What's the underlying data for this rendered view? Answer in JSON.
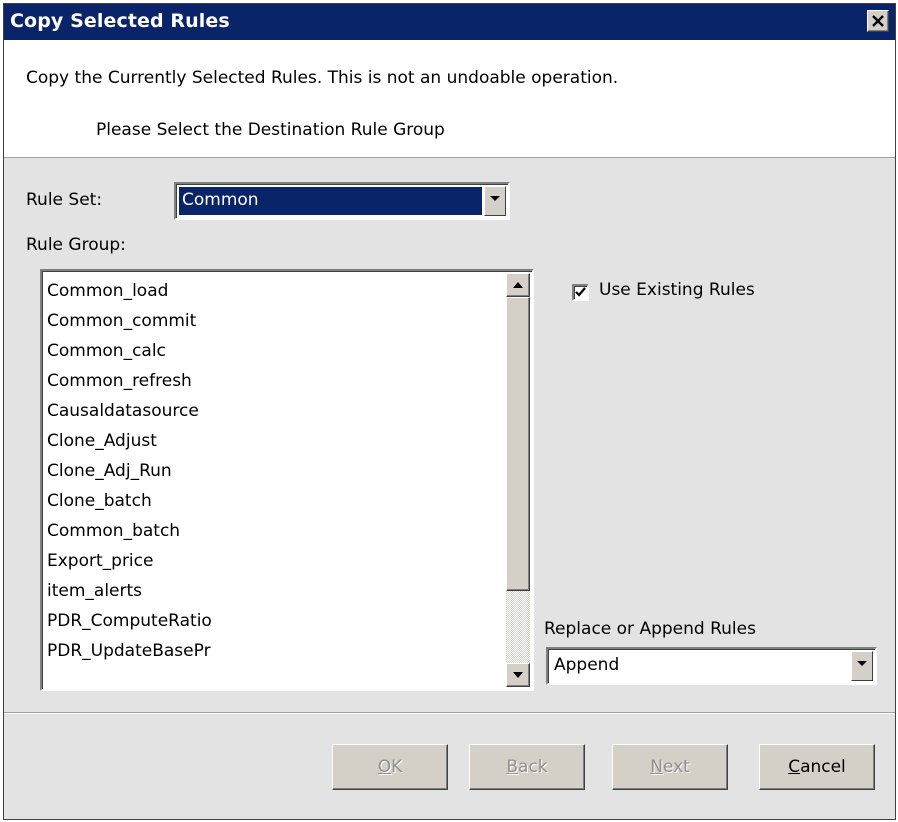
{
  "window": {
    "title": "Copy Selected Rules",
    "close_icon": "close-icon"
  },
  "header": {
    "line1": "Copy the Currently Selected Rules. This is not an undoable operation.",
    "line2": "Please Select the Destination Rule Group"
  },
  "rule_set": {
    "label": "Rule Set:",
    "value": "Common"
  },
  "rule_group": {
    "label": "Rule Group:",
    "items": [
      "Common_load",
      "Common_commit",
      "Common_calc",
      "Common_refresh",
      "Causaldatasource",
      "Clone_Adjust",
      "Clone_Adj_Run",
      "Clone_batch",
      "Common_batch",
      "Export_price",
      "item_alerts",
      "PDR_ComputeRatio",
      "PDR_UpdateBasePr"
    ]
  },
  "use_existing": {
    "label": "Use Existing Rules",
    "checked": true
  },
  "replace_append": {
    "label": "Replace or Append Rules",
    "value": "Append"
  },
  "buttons": {
    "ok": {
      "mnemonic": "O",
      "rest": "K"
    },
    "back": {
      "mnemonic": "B",
      "rest": "ack"
    },
    "next": {
      "mnemonic": "N",
      "rest": "ext"
    },
    "cancel": {
      "mnemonic": "C",
      "rest": "ancel"
    }
  }
}
